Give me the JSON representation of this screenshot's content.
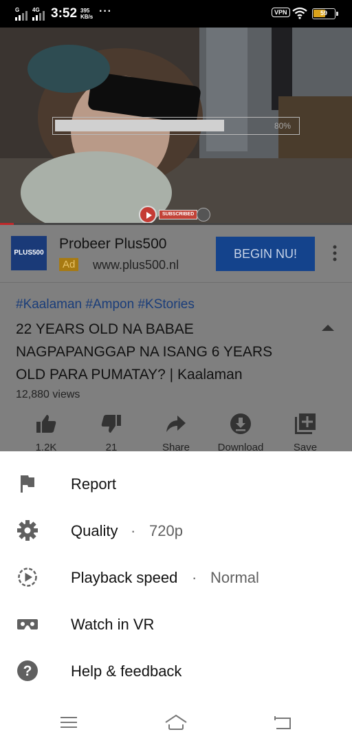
{
  "status_bar": {
    "network_1": "G",
    "network_2": "4G",
    "time": "3:52",
    "speed_value": "395",
    "speed_unit": "KB/s",
    "overflow": "···",
    "vpn": "VPN",
    "battery": "59",
    "battery_level": 0.59
  },
  "video": {
    "buffer_percent_label": "80%",
    "buffer_fraction": 0.7,
    "playback_fraction": 0.04,
    "subscribed_label": "SUBSCRIBED"
  },
  "ad": {
    "logo_text": "PLUS500",
    "title": "Probeer Plus500",
    "tag": "Ad",
    "url": "www.plus500.nl",
    "cta": "BEGIN NU!"
  },
  "info": {
    "hashtags": "#Kaalaman #Ampon #KStories",
    "title": "22 YEARS OLD NA BABAE NAGPAPANGGAP NA ISANG 6 YEARS OLD PARA PUMATAY? | Kaalaman",
    "views": "12,880 views",
    "actions": [
      {
        "icon": "thumbs-up-icon",
        "label": "1.2K"
      },
      {
        "icon": "thumbs-down-icon",
        "label": "21"
      },
      {
        "icon": "share-icon",
        "label": "Share"
      },
      {
        "icon": "download-icon",
        "label": "Download"
      },
      {
        "icon": "save-playlist-icon",
        "label": "Save"
      }
    ]
  },
  "menu": {
    "items": [
      {
        "icon": "flag-icon",
        "label": "Report",
        "value": ""
      },
      {
        "icon": "gear-icon",
        "label": "Quality",
        "value": "720p"
      },
      {
        "icon": "playback-speed-icon",
        "label": "Playback speed",
        "value": "Normal"
      },
      {
        "icon": "vr-headset-icon",
        "label": "Watch in VR",
        "value": ""
      },
      {
        "icon": "help-icon",
        "label": "Help & feedback",
        "value": ""
      }
    ],
    "separator": "·"
  },
  "nav": {
    "buttons": [
      "menu-icon",
      "home-icon",
      "back-icon"
    ]
  }
}
